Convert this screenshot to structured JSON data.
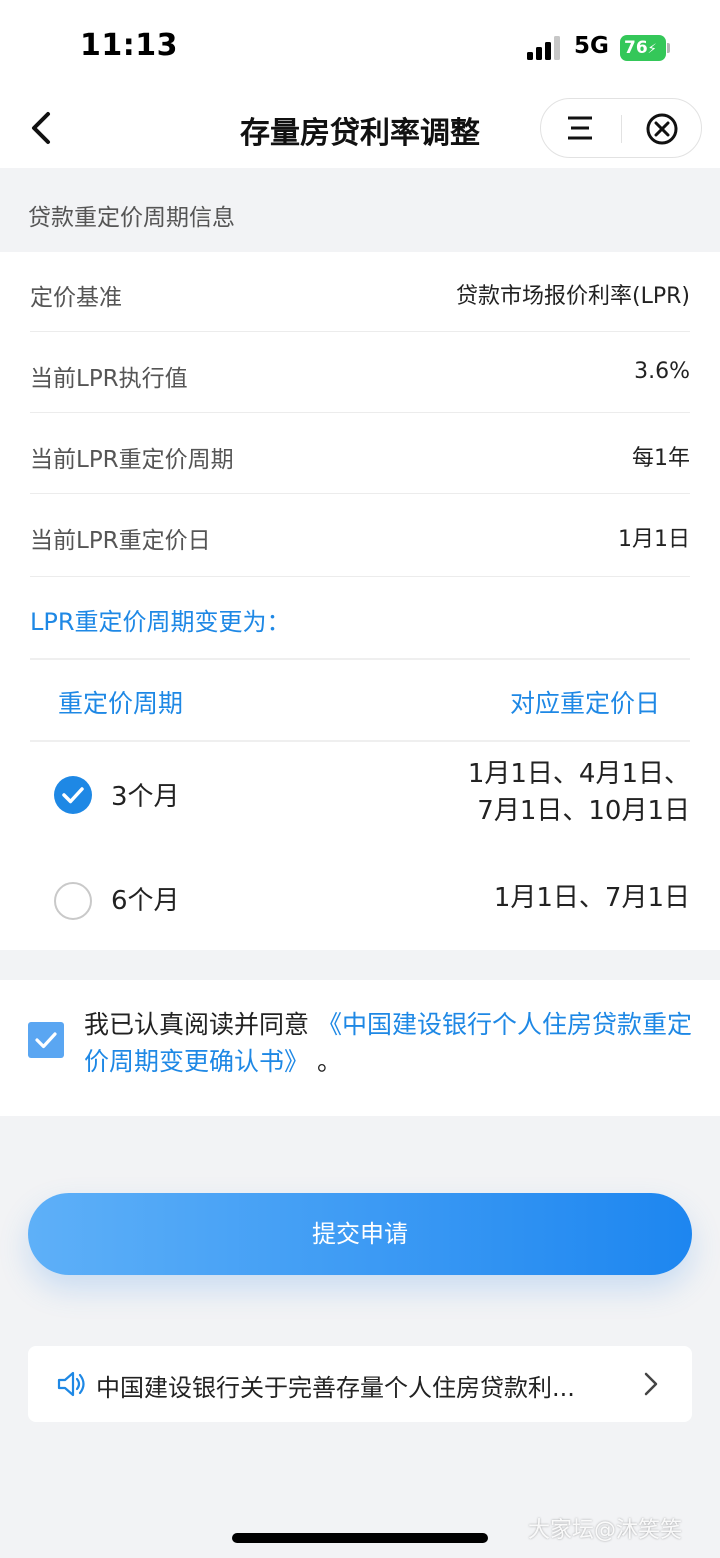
{
  "status_bar": {
    "time": "11:13",
    "network": "5G",
    "battery": "76"
  },
  "nav": {
    "title": "存量房贷利率调整"
  },
  "section": {
    "title": "贷款重定价周期信息"
  },
  "info_rows": [
    {
      "label": "定价基准",
      "value": "贷款市场报价利率(LPR)"
    },
    {
      "label": "当前LPR执行值",
      "value": "3.6%"
    },
    {
      "label": "当前LPR重定价周期",
      "value": "每1年"
    },
    {
      "label": "当前LPR重定价日",
      "value": "1月1日"
    }
  ],
  "change": {
    "title": "LPR重定价周期变更为：",
    "col_period": "重定价周期",
    "col_date": "对应重定价日",
    "options": [
      {
        "label": "3个月",
        "dates_line1": "1月1日、4月1日、",
        "dates_line2": "7月1日、10月1日",
        "selected": true
      },
      {
        "label": "6个月",
        "dates_line1": "1月1日、7月1日",
        "selected": false
      }
    ]
  },
  "agreement": {
    "checked": true,
    "prefix": "我已认真阅读并同意",
    "link": "《中国建设银行个人住房贷款重定价周期变更确认书》",
    "suffix": "。"
  },
  "submit": {
    "label": "提交申请"
  },
  "notice": {
    "text": "中国建设银行关于完善存量个人住房贷款利..."
  },
  "watermark": "大家坛@沐笑笑",
  "colors": {
    "accent": "#1e88e5",
    "battery": "#34c759"
  }
}
